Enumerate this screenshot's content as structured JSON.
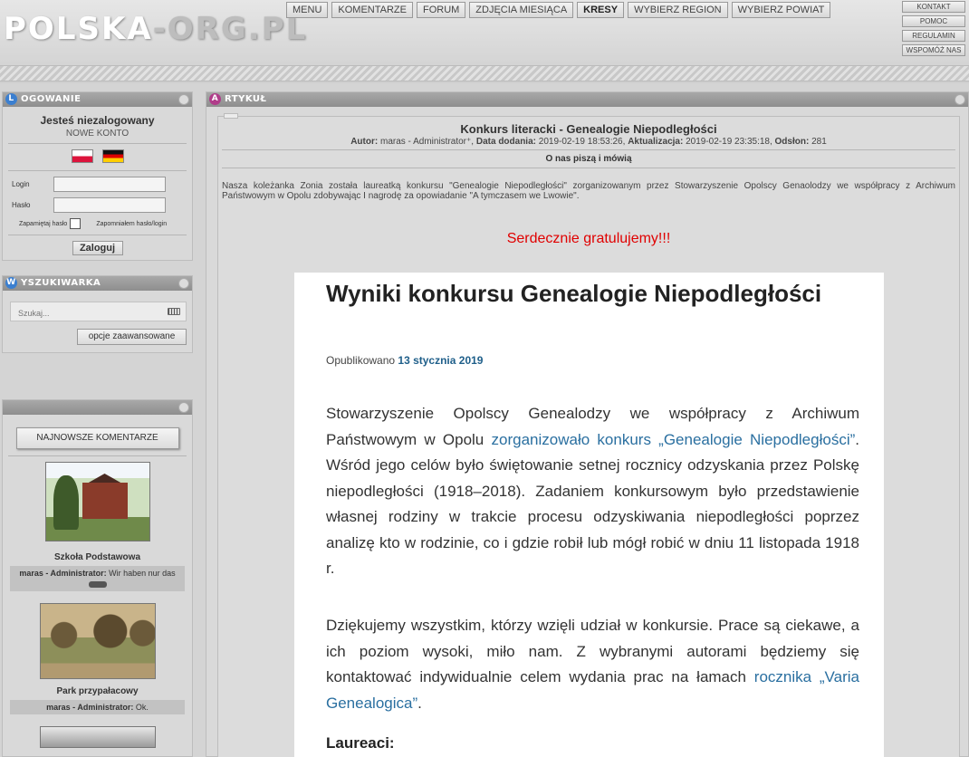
{
  "header": {
    "logo_main": "POLSKA",
    "logo_rest": "-ORG.PL",
    "nav": [
      "MENU",
      "KOMENTARZE",
      "FORUM",
      "ZDJĘCIA MIESIĄCA",
      "KRESY",
      "WYBIERZ REGION",
      "WYBIERZ POWIAT"
    ],
    "side_nav": [
      "KONTAKT",
      "POMOC",
      "REGULAMIN",
      "WSPOMÓŻ NAS"
    ]
  },
  "login": {
    "title": "OGOWANIE",
    "title_letter": "L",
    "status": "Jesteś niezalogowany",
    "new_account": "NOWE KONTO",
    "login_label": "Login",
    "password_label": "Hasło",
    "remember_label": "Zapamiętaj hasło",
    "forgot_label": "Zapomniałem hasło/login",
    "submit": "Zaloguj"
  },
  "search": {
    "title": "YSZUKIWARKA",
    "title_letter": "W",
    "placeholder": "Szukaj...",
    "advanced": "opcje zaawansowane"
  },
  "comments": {
    "button": "NAJNOWSZE KOMENTARZE",
    "items": [
      {
        "title": "Szkoła Podstawowa",
        "author": "maras - Administrator:",
        "text": "Wir haben nur das"
      },
      {
        "title": "Park przypałacowy",
        "author": "maras - Administrator:",
        "text": "Ok."
      }
    ]
  },
  "article": {
    "panel_title": "RTYKUŁ",
    "panel_letter": "A",
    "title": "Konkurs literacki - Genealogie Niepodległości",
    "meta_author_label": "Autor:",
    "meta_author": "maras - Administrator",
    "meta_added_label": "Data dodania:",
    "meta_added": "2019-02-19 18:53:26",
    "meta_updated_label": "Aktualizacja:",
    "meta_updated": "2019-02-19 23:35:18",
    "meta_views_label": "Odsłon:",
    "meta_views": "281",
    "section": "O nas piszą i mówią",
    "body": "Nasza koleżanka Zonia została laureatką konkursu \"Genealogie Niepodległości\" zorganizowanym przez Stowarzyszenie Opolscy Genaolodzy we współpracy z Archiwum Państwowym w Opolu zdobywając I nagrodę za opowiadanie \"A tymczasem we Lwowie\".",
    "congrats": "Serdecznie gratulujemy!!!",
    "embedded": {
      "heading": "Wyniki konkursu Genealogie Niepodległości",
      "published_label": "Opublikowano",
      "published_date": "13 stycznia 2019",
      "p1_a": "Stowarzyszenie Opolscy Genealodzy we współpracy z Archiwum Państwowym w Opolu ",
      "p1_link": "zorganizowało konkurs „Genealogie Niepodległości”",
      "p1_b": ". Wśród jego celów było świętowanie setnej rocznicy odzyskania przez Polskę niepodległości (1918–2018). Zadaniem konkursowym było przedstawienie własnej rodziny w trakcie procesu odzyskiwania niepodległości poprzez analizę kto w rodzinie, co i gdzie robił lub mógł robić w dniu 11 listopada 1918 r.",
      "p2_a": "Dziękujemy wszystkim, którzy wzięli udział w konkursie. Prace są ciekawe, a ich poziom wysoki, miło nam. Z wybranymi autorami będziemy się kontaktować indywidualnie celem wydania prac na łamach ",
      "p2_link": "rocznika „Varia Genealogica”",
      "p2_b": ".",
      "laureaci": "Laureaci:"
    }
  },
  "colors": {
    "accent_red": "#e00000",
    "link_blue": "#2a6fa0",
    "panel_bg": "#d9d9d9"
  }
}
